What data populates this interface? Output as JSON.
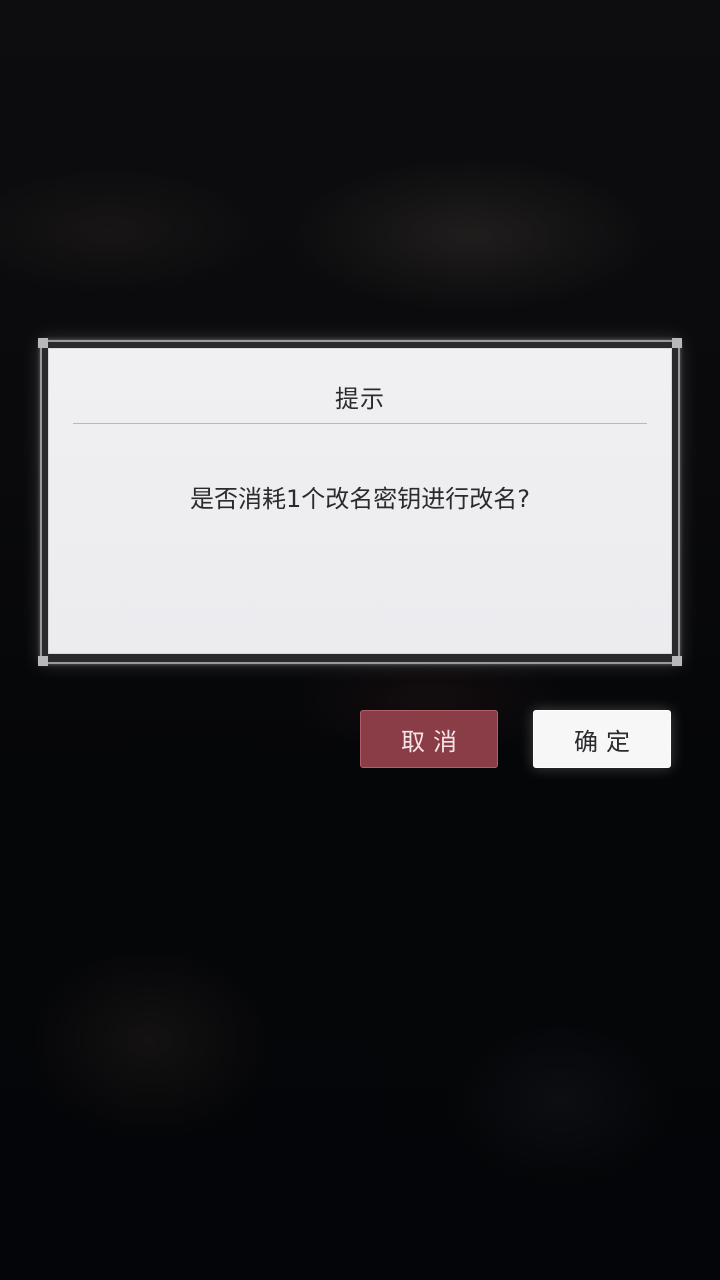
{
  "dialog": {
    "title": "提示",
    "message": "是否消耗1个改名密钥进行改名?"
  },
  "buttons": {
    "cancel_label": "取消",
    "confirm_label": "确定"
  },
  "colors": {
    "cancel_button": "#8a3d46",
    "confirm_button": "#f7f7f8",
    "background": "#050608"
  }
}
